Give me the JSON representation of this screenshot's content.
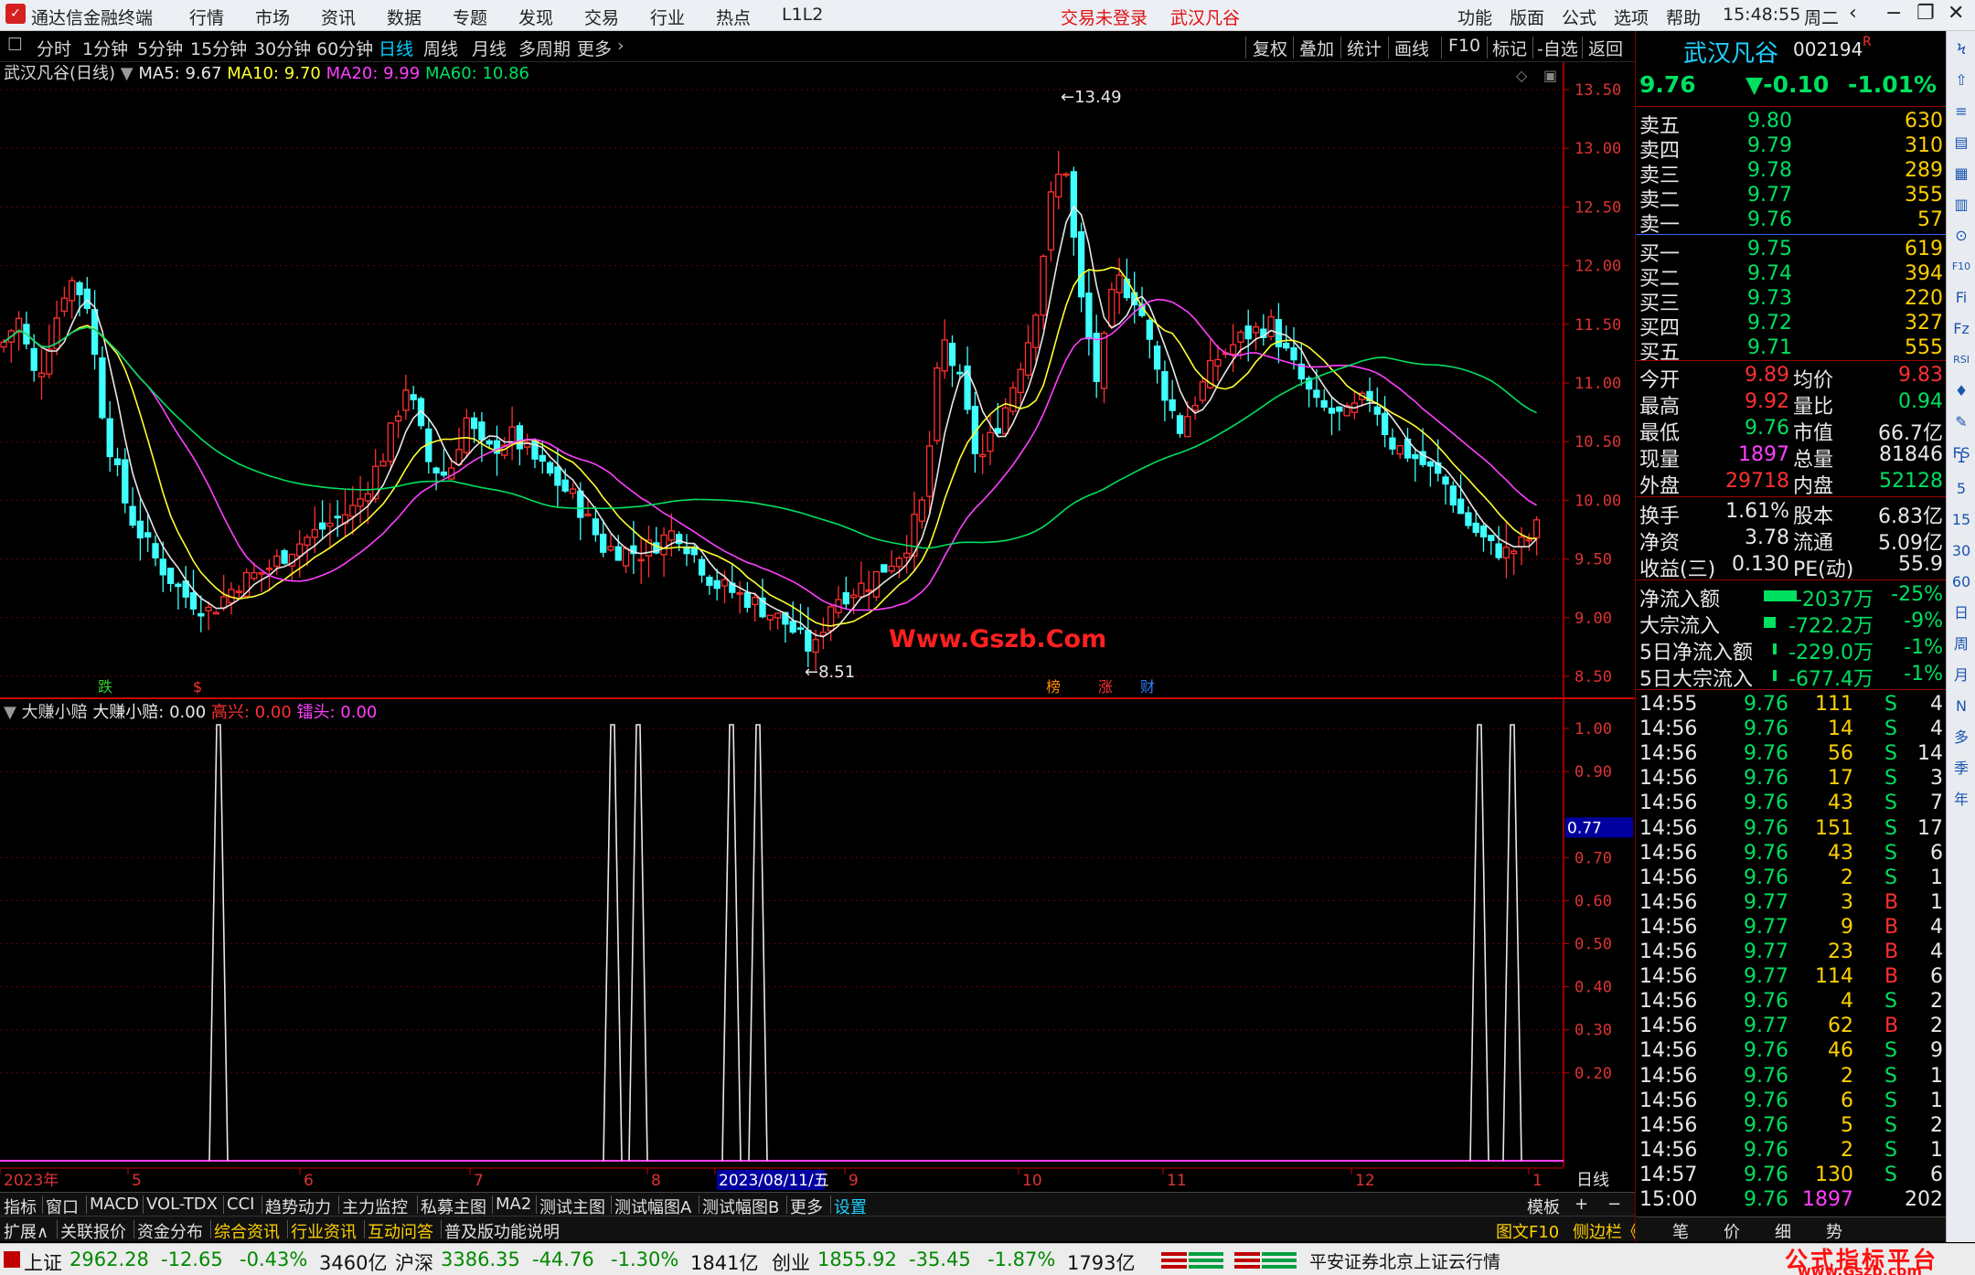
{
  "app": {
    "title": "通达信金融终端",
    "menus": [
      "行情",
      "市场",
      "资讯",
      "数据",
      "专题",
      "发现",
      "交易",
      "行业",
      "热点",
      "L1L2"
    ],
    "login_status": "交易未登录",
    "stock_tab": "武汉凡谷",
    "right_menus": [
      "功能",
      "版面",
      "公式",
      "选项",
      "帮助"
    ],
    "time": "15:48:55",
    "weekday": "周二"
  },
  "toolbar": {
    "periods": [
      "分时",
      "1分钟",
      "5分钟",
      "15分钟",
      "30分钟",
      "60分钟",
      "日线",
      "周线",
      "月线",
      "多周期",
      "更多"
    ],
    "selected": "日线",
    "actions": [
      "复权",
      "叠加",
      "统计",
      "画线",
      "F10",
      "标记",
      "-自选",
      "返回"
    ]
  },
  "chart": {
    "stock_label": "武汉凡谷(日线)",
    "ma_labels": [
      {
        "text": "MA5: 9.67",
        "color": "#e8e8e8"
      },
      {
        "text": "MA10: 9.70",
        "color": "#ffff30"
      },
      {
        "text": "MA20: 9.99",
        "color": "#ff40ff"
      },
      {
        "text": "MA60: 10.86",
        "color": "#00e060"
      }
    ],
    "price_ticks": [
      "13.50",
      "13.00",
      "12.50",
      "12.00",
      "11.50",
      "11.00",
      "10.50",
      "10.00",
      "9.50",
      "9.00",
      "8.50"
    ],
    "high_mark": "13.49",
    "low_mark": "8.51",
    "watermark": "Www.Gszb.Com",
    "event_marks": [
      "跌",
      "$",
      "榜",
      "涨",
      "财"
    ]
  },
  "indicator": {
    "name": "大赚小赔",
    "values": [
      {
        "text": "大赚小赔: 0.00",
        "color": "#e8e8e8"
      },
      {
        "text": "高兴: 0.00",
        "color": "#ff3030"
      },
      {
        "text": "镭头: 0.00",
        "color": "#ff40ff"
      }
    ],
    "ticks": [
      "1.00",
      "0.90",
      "0.70",
      "0.60",
      "0.50",
      "0.40",
      "0.30",
      "0.20"
    ],
    "cursor_value": "0.77"
  },
  "date_axis": {
    "labels": [
      "2023年",
      "5",
      "6",
      "7",
      "8",
      "2023/08/11/五",
      "9",
      "10",
      "11",
      "12",
      "1"
    ],
    "period": "日线"
  },
  "bottom_tabs": {
    "left": [
      "指标",
      "窗口",
      "MACD",
      "VOL-TDX",
      "CCI",
      "趋势动力",
      "主力监控",
      "私募主图",
      "MA2",
      "测试主图",
      "测试幅图A",
      "测试幅图B",
      "更多",
      "设置"
    ],
    "right": [
      "模板",
      "+",
      "−"
    ]
  },
  "bottom_tabs2": {
    "left": [
      "扩展∧",
      "关联报价",
      "资金分布",
      "综合资讯",
      "行业资讯",
      "互动问答",
      "普及版功能说明"
    ],
    "right": [
      "图文F10",
      "侧边栏《",
      "笔",
      "价",
      "细",
      "势"
    ]
  },
  "quote": {
    "name": "武汉凡谷",
    "code": "002194",
    "code_flag": "R",
    "price": "9.76",
    "change": "▼-0.10",
    "pct": "-1.01%",
    "asks": [
      {
        "label": "卖五",
        "price": "9.80",
        "vol": "630"
      },
      {
        "label": "卖四",
        "price": "9.79",
        "vol": "310"
      },
      {
        "label": "卖三",
        "price": "9.78",
        "vol": "289"
      },
      {
        "label": "卖二",
        "price": "9.77",
        "vol": "355"
      },
      {
        "label": "卖一",
        "price": "9.76",
        "vol": "57"
      }
    ],
    "bids": [
      {
        "label": "买一",
        "price": "9.75",
        "vol": "619"
      },
      {
        "label": "买二",
        "price": "9.74",
        "vol": "394"
      },
      {
        "label": "买三",
        "price": "9.73",
        "vol": "220"
      },
      {
        "label": "买四",
        "price": "9.72",
        "vol": "327"
      },
      {
        "label": "买五",
        "price": "9.71",
        "vol": "555"
      }
    ],
    "stats": [
      {
        "l1": "今开",
        "v1": "9.89",
        "c1": "r",
        "l2": "均价",
        "v2": "9.83",
        "c2": "r"
      },
      {
        "l1": "最高",
        "v1": "9.92",
        "c1": "r",
        "l2": "量比",
        "v2": "0.94",
        "c2": "g"
      },
      {
        "l1": "最低",
        "v1": "9.76",
        "c1": "g",
        "l2": "市值",
        "v2": "66.7亿",
        "c2": "w"
      },
      {
        "l1": "现量",
        "v1": "1897",
        "c1": "m",
        "l2": "总量",
        "v2": "81846",
        "c2": "w"
      },
      {
        "l1": "外盘",
        "v1": "29718",
        "c1": "r",
        "l2": "内盘",
        "v2": "52128",
        "c2": "g"
      }
    ],
    "stats2": [
      {
        "l1": "换手",
        "v1": "1.61%",
        "l2": "股本",
        "v2": "6.83亿"
      },
      {
        "l1": "净资",
        "v1": "3.78",
        "l2": "流通",
        "v2": "5.09亿"
      },
      {
        "l1": "收益(三)",
        "v1": "0.130",
        "l2": "PE(动)",
        "v2": "55.9"
      }
    ],
    "flows": [
      {
        "label": "净流入额",
        "value": "-2037万",
        "pct": "-25%",
        "bar": 1.0
      },
      {
        "label": "大宗流入",
        "value": "-722.2万",
        "pct": "-9%",
        "bar": 0.35
      },
      {
        "label": "5日净流入额",
        "value": "-229.0万",
        "pct": "-1%",
        "bar": 0.12
      },
      {
        "label": "5日大宗流入",
        "value": "-677.4万",
        "pct": "-1%",
        "bar": 0.12
      }
    ],
    "ticks": [
      {
        "t": "14:55",
        "p": "9.76",
        "v": "111",
        "s": "S",
        "n": "4"
      },
      {
        "t": "14:56",
        "p": "9.76",
        "v": "14",
        "s": "S",
        "n": "4"
      },
      {
        "t": "14:56",
        "p": "9.76",
        "v": "56",
        "s": "S",
        "n": "14"
      },
      {
        "t": "14:56",
        "p": "9.76",
        "v": "17",
        "s": "S",
        "n": "3"
      },
      {
        "t": "14:56",
        "p": "9.76",
        "v": "43",
        "s": "S",
        "n": "7"
      },
      {
        "t": "14:56",
        "p": "9.76",
        "v": "151",
        "s": "S",
        "n": "17"
      },
      {
        "t": "14:56",
        "p": "9.76",
        "v": "43",
        "s": "S",
        "n": "6"
      },
      {
        "t": "14:56",
        "p": "9.76",
        "v": "2",
        "s": "S",
        "n": "1"
      },
      {
        "t": "14:56",
        "p": "9.77",
        "v": "3",
        "s": "B",
        "n": "1"
      },
      {
        "t": "14:56",
        "p": "9.77",
        "v": "9",
        "s": "B",
        "n": "4"
      },
      {
        "t": "14:56",
        "p": "9.77",
        "v": "23",
        "s": "B",
        "n": "4"
      },
      {
        "t": "14:56",
        "p": "9.77",
        "v": "114",
        "s": "B",
        "n": "6"
      },
      {
        "t": "14:56",
        "p": "9.76",
        "v": "4",
        "s": "S",
        "n": "2"
      },
      {
        "t": "14:56",
        "p": "9.77",
        "v": "62",
        "s": "B",
        "n": "2"
      },
      {
        "t": "14:56",
        "p": "9.76",
        "v": "46",
        "s": "S",
        "n": "9"
      },
      {
        "t": "14:56",
        "p": "9.76",
        "v": "2",
        "s": "S",
        "n": "1"
      },
      {
        "t": "14:56",
        "p": "9.76",
        "v": "6",
        "s": "S",
        "n": "1"
      },
      {
        "t": "14:56",
        "p": "9.76",
        "v": "5",
        "s": "S",
        "n": "2"
      },
      {
        "t": "14:56",
        "p": "9.76",
        "v": "2",
        "s": "S",
        "n": "1"
      },
      {
        "t": "14:57",
        "p": "9.76",
        "v": "130",
        "s": "S",
        "n": "6"
      },
      {
        "t": "15:00",
        "p": "9.76",
        "v": "1897",
        "s": "",
        "n": "202"
      }
    ]
  },
  "rail": [
    "Ϟ",
    "⇧",
    "≡",
    "▤",
    "▦",
    "▥",
    "⊙",
    "F10",
    "Fi",
    "Fz",
    "RSI",
    "♦",
    "✎",
    "FS",
    "1",
    "5",
    "15",
    "30",
    "60",
    "日",
    "周",
    "月",
    "N",
    "多",
    "季",
    "年"
  ],
  "status": {
    "indices": [
      {
        "name": "上证",
        "value": "2962.28",
        "chg": "-12.65",
        "pct": "-0.43%",
        "amt": "3460亿"
      },
      {
        "name": "沪深",
        "value": "3386.35",
        "chg": "-44.76",
        "pct": "-1.30%",
        "amt": "1841亿"
      },
      {
        "name": "创业",
        "value": "1855.92",
        "chg": "-35.45",
        "pct": "-1.87%",
        "amt": "1793亿"
      }
    ],
    "broker": "平安证券北京上证云行情",
    "brand": "公式指标平台",
    "brand_url": "www.Gszb.com"
  }
}
